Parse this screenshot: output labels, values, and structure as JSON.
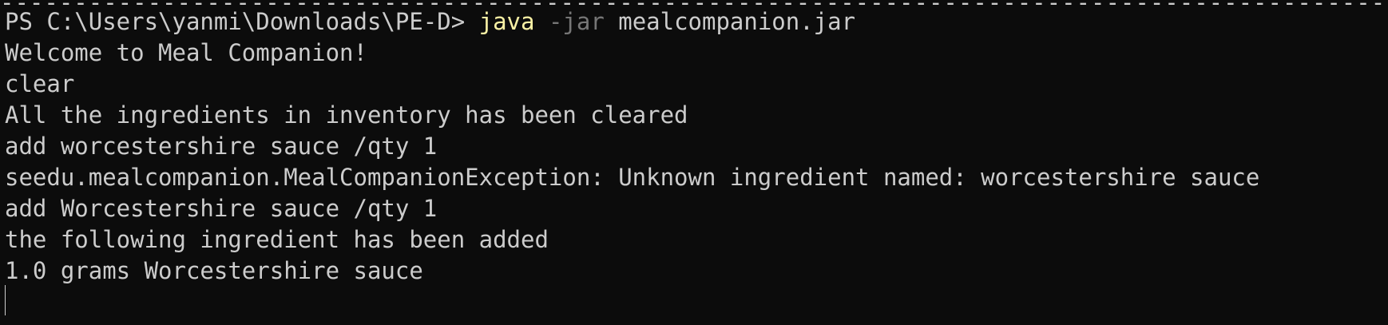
{
  "terminal": {
    "top_rule": "----------------------------------------------------------------------------------------------------------------------------------------------------------------",
    "prompt": "PS C:\\Users\\yanmi\\Downloads\\PE-D> ",
    "command": "java",
    "flag": "-jar",
    "argument": " mealcompanion.jar",
    "output_lines": [
      "Welcome to Meal Companion!",
      "clear",
      "All the ingredients in inventory has been cleared",
      "add worcestershire sauce /qty 1",
      "seedu.mealcompanion.MealCompanionException: Unknown ingredient named: worcestershire sauce",
      "add Worcestershire sauce /qty 1",
      "the following ingredient has been added",
      "1.0 grams Worcestershire sauce"
    ],
    "colors": {
      "background": "#0c0c0c",
      "text": "#cccccc",
      "command": "#f9f1a5",
      "flag": "#767676"
    }
  }
}
